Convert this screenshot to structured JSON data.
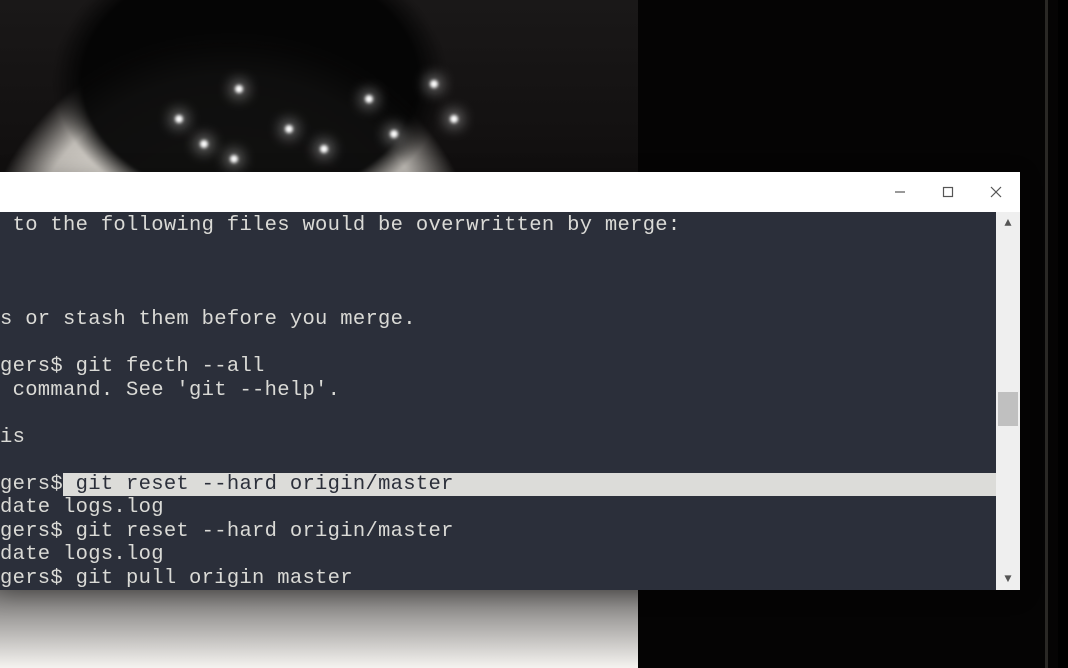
{
  "terminal": {
    "lines": [
      {
        "text": " to the following files would be overwritten by merge:",
        "hl": false
      },
      {
        "text": "",
        "hl": false
      },
      {
        "text": "",
        "hl": false
      },
      {
        "text": "",
        "hl": false
      },
      {
        "text": "s or stash them before you merge.",
        "hl": false
      },
      {
        "text": "",
        "hl": false
      },
      {
        "text": "gers$ git fecth --all",
        "hl": false
      },
      {
        "text": " command. See 'git --help'.",
        "hl": false
      },
      {
        "text": "",
        "hl": false
      },
      {
        "text": "is",
        "hl": false
      },
      {
        "text": "",
        "hl": false
      },
      {
        "prefix": "gers$",
        "text": " git reset --hard origin/master",
        "hl": true
      },
      {
        "text": "date logs.log",
        "hl": false
      },
      {
        "text": "gers$ git reset --hard origin/master",
        "hl": false
      },
      {
        "text": "date logs.log",
        "hl": false
      },
      {
        "text": "gers$ git pull origin master",
        "hl": false
      }
    ],
    "cols_to_fill": 88
  },
  "window_controls": {
    "minimize": "minimize",
    "maximize": "maximize",
    "close": "close"
  },
  "scrollbar": {
    "up": "▲",
    "down": "▼"
  }
}
